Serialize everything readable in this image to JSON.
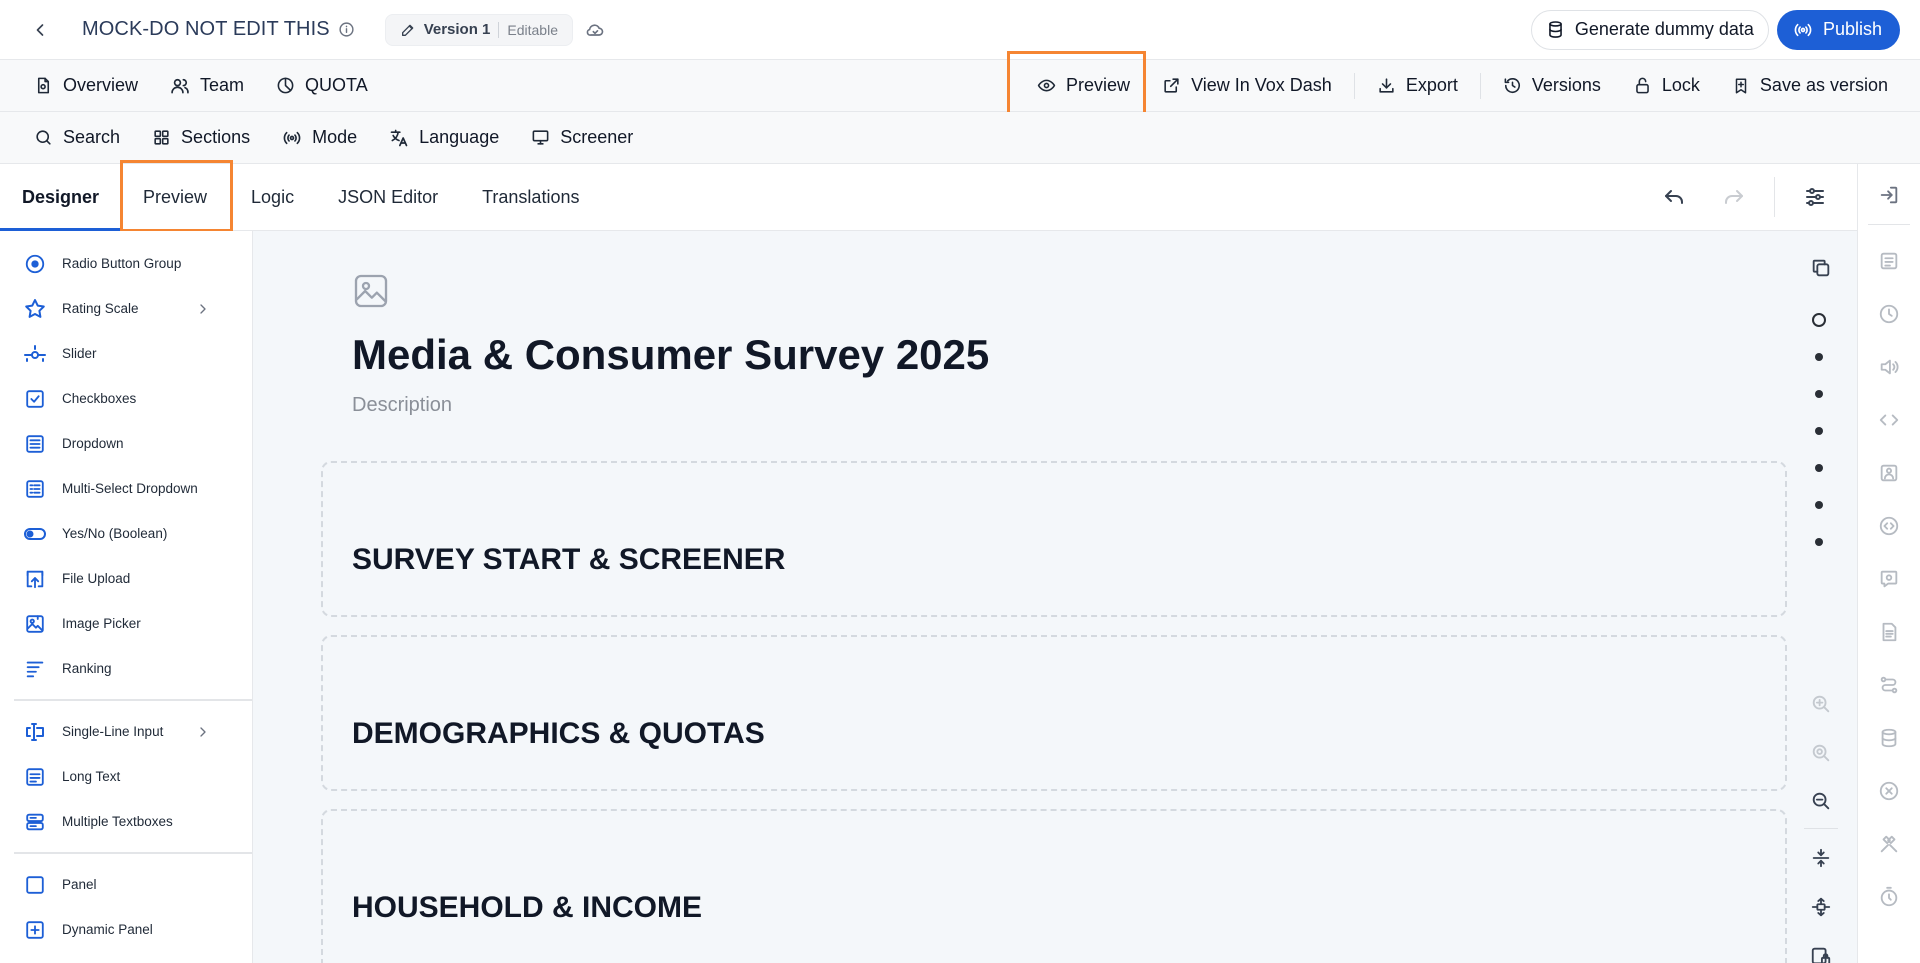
{
  "topbar": {
    "title": "MOCK-DO NOT EDIT THIS",
    "version_label": "Version 1",
    "version_state": "Editable",
    "generate_label": "Generate dummy data",
    "publish_label": "Publish"
  },
  "toolbar2": {
    "left": [
      {
        "label": "Overview",
        "icon": "document-icon"
      },
      {
        "label": "Team",
        "icon": "users-icon"
      },
      {
        "label": "QUOTA",
        "icon": "pie-chart-icon"
      }
    ],
    "preview_label": "Preview",
    "view_vox_label": "View In Vox Dash",
    "export_label": "Export",
    "versions_label": "Versions",
    "lock_label": "Lock",
    "save_version_label": "Save as version"
  },
  "toolbar3": {
    "search_label": "Search",
    "sections_label": "Sections",
    "mode_label": "Mode",
    "language_label": "Language",
    "screener_label": "Screener"
  },
  "tabs": {
    "designer": "Designer",
    "preview": "Preview",
    "logic": "Logic",
    "json_editor": "JSON Editor",
    "translations": "Translations"
  },
  "toolbox": {
    "group1": [
      "Radio Button Group",
      "Rating Scale",
      "Slider",
      "Checkboxes",
      "Dropdown",
      "Multi-Select Dropdown",
      "Yes/No (Boolean)",
      "File Upload",
      "Image Picker",
      "Ranking"
    ],
    "group2": [
      "Single-Line Input",
      "Long Text",
      "Multiple Textboxes"
    ],
    "group3": [
      "Panel",
      "Dynamic Panel"
    ]
  },
  "survey": {
    "title": "Media & Consumer Survey 2025",
    "description": "Description",
    "sections": [
      "SURVEY START & SCREENER",
      "DEMOGRAPHICS & QUOTAS",
      "HOUSEHOLD & INCOME"
    ]
  },
  "colors": {
    "accent": "#1d5fd6",
    "highlight": "#f58532"
  }
}
